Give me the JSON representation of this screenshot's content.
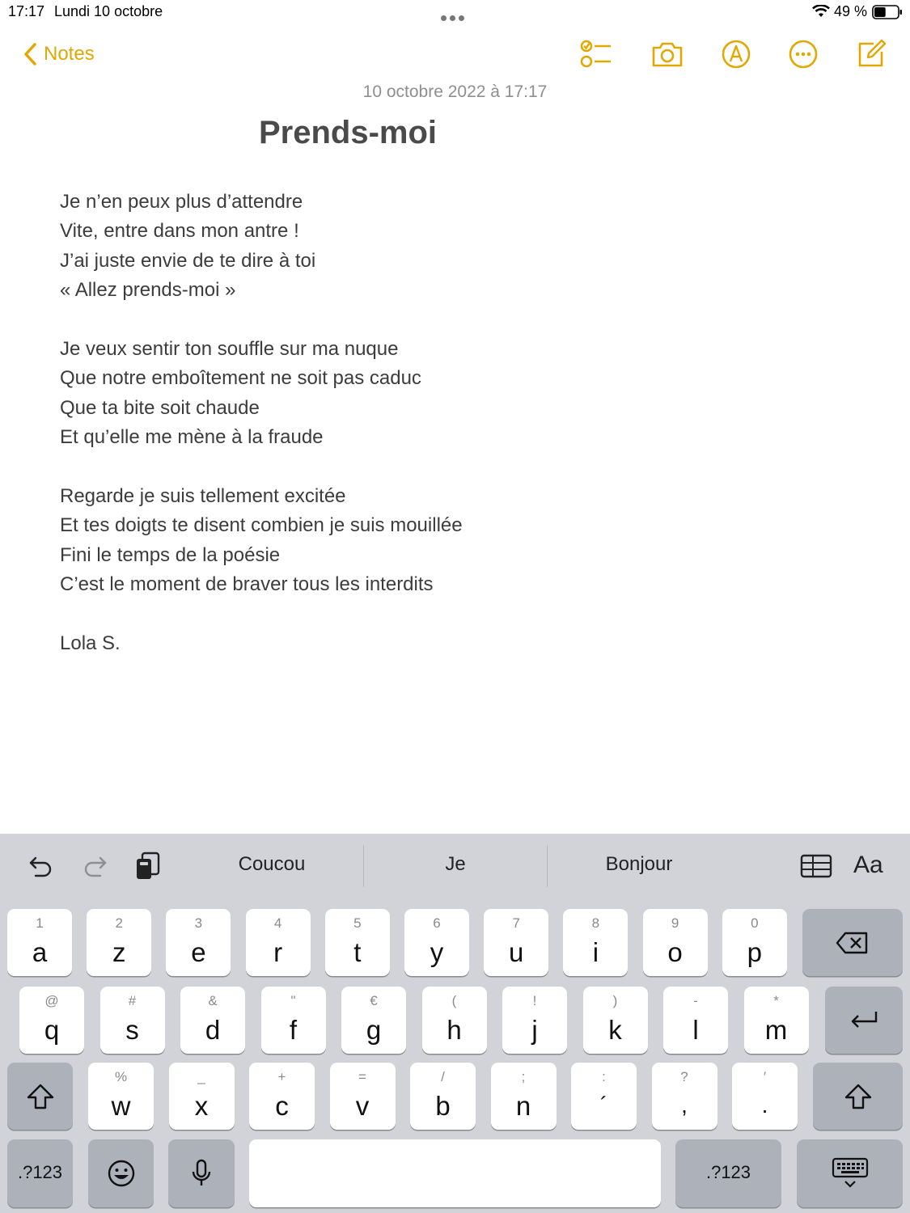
{
  "status_bar": {
    "time": "17:17",
    "date": "Lundi 10 octobre",
    "battery_percent": "49 %",
    "battery_level": 0.49
  },
  "nav": {
    "back_label": "Notes"
  },
  "toolbar_icons": [
    "checklist-icon",
    "camera-icon",
    "markup-pen-icon",
    "more-options-icon",
    "compose-icon"
  ],
  "note": {
    "date": "10 octobre 2022 à 17:17",
    "title": "Prends-moi",
    "lines": [
      "Je n’en peux plus d’attendre",
      "Vite, entre dans mon antre !",
      "J’ai juste envie de te dire à toi",
      "« Allez prends-moi »",
      "",
      "Je veux sentir ton souffle sur ma nuque",
      "Que notre emboîtement ne soit pas caduc",
      "Que ta bite soit chaude",
      "Et qu’elle me mène à la fraude",
      "",
      "Regarde je suis tellement excitée",
      "Et tes doigts te disent combien je suis mouillée",
      "Fini le temps de la poésie",
      "C’est le moment de braver tous les interdits",
      "",
      "Lola S."
    ]
  },
  "keyboard": {
    "suggestions": [
      "Coucou",
      "Je",
      "Bonjour"
    ],
    "format_label": "Aa",
    "row1": [
      {
        "sec": "1",
        "pri": "a"
      },
      {
        "sec": "2",
        "pri": "z"
      },
      {
        "sec": "3",
        "pri": "e"
      },
      {
        "sec": "4",
        "pri": "r"
      },
      {
        "sec": "5",
        "pri": "t"
      },
      {
        "sec": "6",
        "pri": "y"
      },
      {
        "sec": "7",
        "pri": "u"
      },
      {
        "sec": "8",
        "pri": "i"
      },
      {
        "sec": "9",
        "pri": "o"
      },
      {
        "sec": "0",
        "pri": "p"
      }
    ],
    "row2": [
      {
        "sec": "@",
        "pri": "q"
      },
      {
        "sec": "#",
        "pri": "s"
      },
      {
        "sec": "&",
        "pri": "d"
      },
      {
        "sec": "\"",
        "pri": "f"
      },
      {
        "sec": "€",
        "pri": "g"
      },
      {
        "sec": "(",
        "pri": "h"
      },
      {
        "sec": "!",
        "pri": "j"
      },
      {
        "sec": ")",
        "pri": "k"
      },
      {
        "sec": "-",
        "pri": "l"
      },
      {
        "sec": "*",
        "pri": "m"
      }
    ],
    "row3": [
      {
        "sec": "%",
        "pri": "w"
      },
      {
        "sec": "_",
        "pri": "x"
      },
      {
        "sec": "+",
        "pri": "c"
      },
      {
        "sec": "=",
        "pri": "v"
      },
      {
        "sec": "/",
        "pri": "b"
      },
      {
        "sec": ";",
        "pri": "n"
      },
      {
        "sec": ":",
        "pri": "´"
      },
      {
        "sec": "?",
        "pri": ","
      },
      {
        "sec": "′",
        "pri": "."
      }
    ],
    "numbers_label": ".?123"
  }
}
